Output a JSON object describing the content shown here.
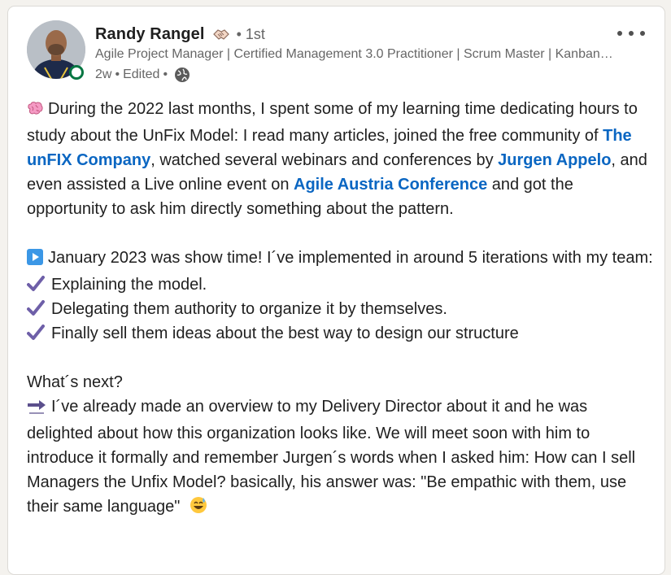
{
  "author": {
    "name": "Randy Rangel",
    "degree": "1st",
    "headline": "Agile Project Manager | Certified Management 3.0 Practitioner | Scrum Master | Kanban Practitioner",
    "time": "2w",
    "edited": "Edited",
    "visibility_icon": "globe-icon",
    "badge_icon": "handshake-icon"
  },
  "post": {
    "p1": {
      "t1": "During the 2022 last months, I spent some of my learning time dedicating hours to study about the UnFix Model: I read many articles, joined the free community of ",
      "m1": "The unFIX Company",
      "t2": ", watched several webinars and conferences by ",
      "m2": "Jurgen Appelo",
      "t3": ", and even assisted a Live online event on ",
      "m3": "Agile Austria Conference",
      "t4": " and got the opportunity to ask him directly something about the pattern."
    },
    "p2": {
      "intro": "January 2023 was show time! I´ve implemented in around 5 iterations with my team:",
      "items": [
        "Explaining the model.",
        "Delegating them authority to organize it by themselves.",
        "Finally sell them ideas about the best way to design our structure"
      ]
    },
    "p3": {
      "heading": "What´s next?",
      "text": "I´ve already made an overview to my Delivery Director about it and he was delighted about how this organization looks like. We will meet soon with him to introduce it formally and remember Jurgen´s words when I asked him: How can I sell Managers the Unfix Model? basically, his answer was: \"Be empathic with them, use their same language\""
    }
  },
  "colors": {
    "link": "#0a66c2",
    "text": "#1f1f1f",
    "muted": "#666666",
    "online": "#057642",
    "check": "#6e5fa8"
  }
}
